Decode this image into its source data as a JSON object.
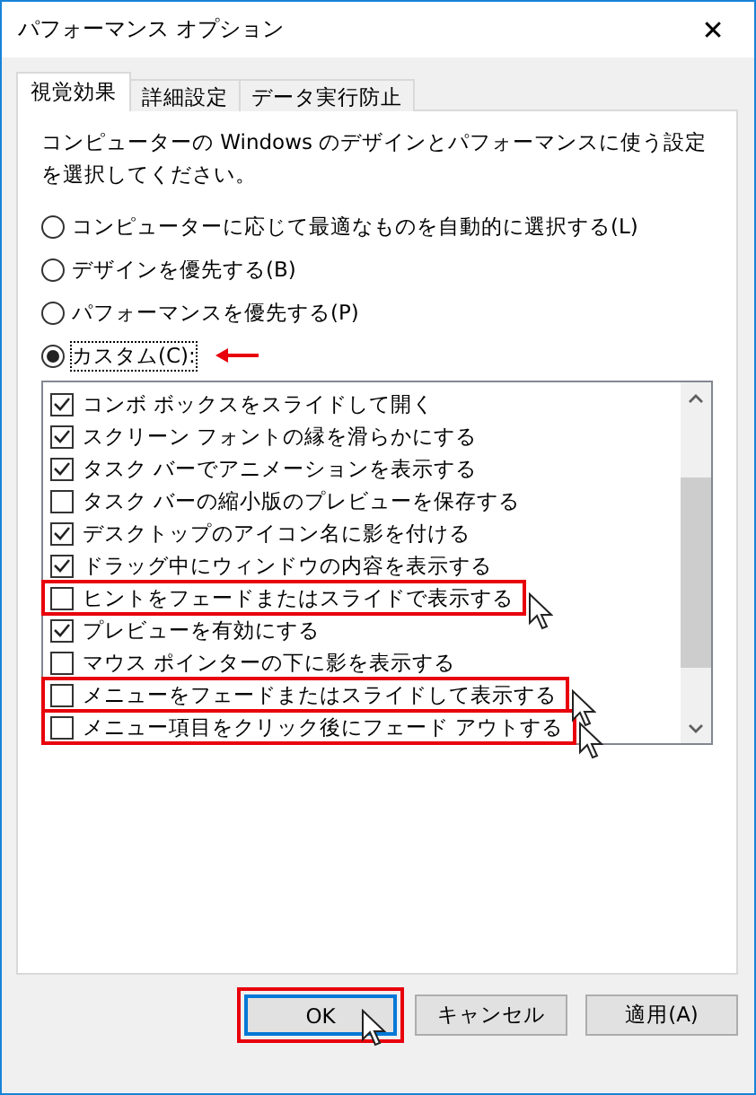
{
  "window": {
    "title": "パフォーマンス オプション",
    "close": "✕"
  },
  "tabs": [
    {
      "label": "視覚効果",
      "selected": true
    },
    {
      "label": "詳細設定",
      "selected": false
    },
    {
      "label": "データ実行防止",
      "selected": false
    }
  ],
  "description": "コンピューターの Windows のデザインとパフォーマンスに使う設定を選択してください。",
  "options": [
    {
      "label": "コンピューターに応じて最適なものを自動的に選択する(L)",
      "selected": false,
      "annotated": false
    },
    {
      "label": "デザインを優先する(B)",
      "selected": false,
      "annotated": false
    },
    {
      "label": "パフォーマンスを優先する(P)",
      "selected": false,
      "annotated": false
    },
    {
      "label": "カスタム(C):",
      "selected": true,
      "annotated": true
    }
  ],
  "effects": [
    {
      "label": "コンボ ボックスをスライドして開く",
      "checked": true,
      "highlighted": false,
      "pointer": false
    },
    {
      "label": "スクリーン フォントの縁を滑らかにする",
      "checked": true,
      "highlighted": false,
      "pointer": false
    },
    {
      "label": "タスク バーでアニメーションを表示する",
      "checked": true,
      "highlighted": false,
      "pointer": false
    },
    {
      "label": "タスク バーの縮小版のプレビューを保存する",
      "checked": false,
      "highlighted": false,
      "pointer": false
    },
    {
      "label": "デスクトップのアイコン名に影を付ける",
      "checked": true,
      "highlighted": false,
      "pointer": false
    },
    {
      "label": "ドラッグ中にウィンドウの内容を表示する",
      "checked": true,
      "highlighted": false,
      "pointer": false
    },
    {
      "label": "ヒントをフェードまたはスライドで表示する",
      "checked": false,
      "highlighted": true,
      "pointer": true
    },
    {
      "label": "プレビューを有効にする",
      "checked": true,
      "highlighted": false,
      "pointer": false
    },
    {
      "label": "マウス ポインターの下に影を表示する",
      "checked": false,
      "highlighted": false,
      "pointer": false
    },
    {
      "label": "メニューをフェードまたはスライドして表示する",
      "checked": false,
      "highlighted": true,
      "pointer": true
    },
    {
      "label": "メニュー項目をクリック後にフェード アウトする",
      "checked": false,
      "highlighted": true,
      "pointer": true
    }
  ],
  "buttons": [
    {
      "label": "OK",
      "default": true,
      "highlighted": true
    },
    {
      "label": "キャンセル",
      "default": false,
      "highlighted": false
    },
    {
      "label": "適用(A)",
      "default": false,
      "highlighted": false
    }
  ]
}
